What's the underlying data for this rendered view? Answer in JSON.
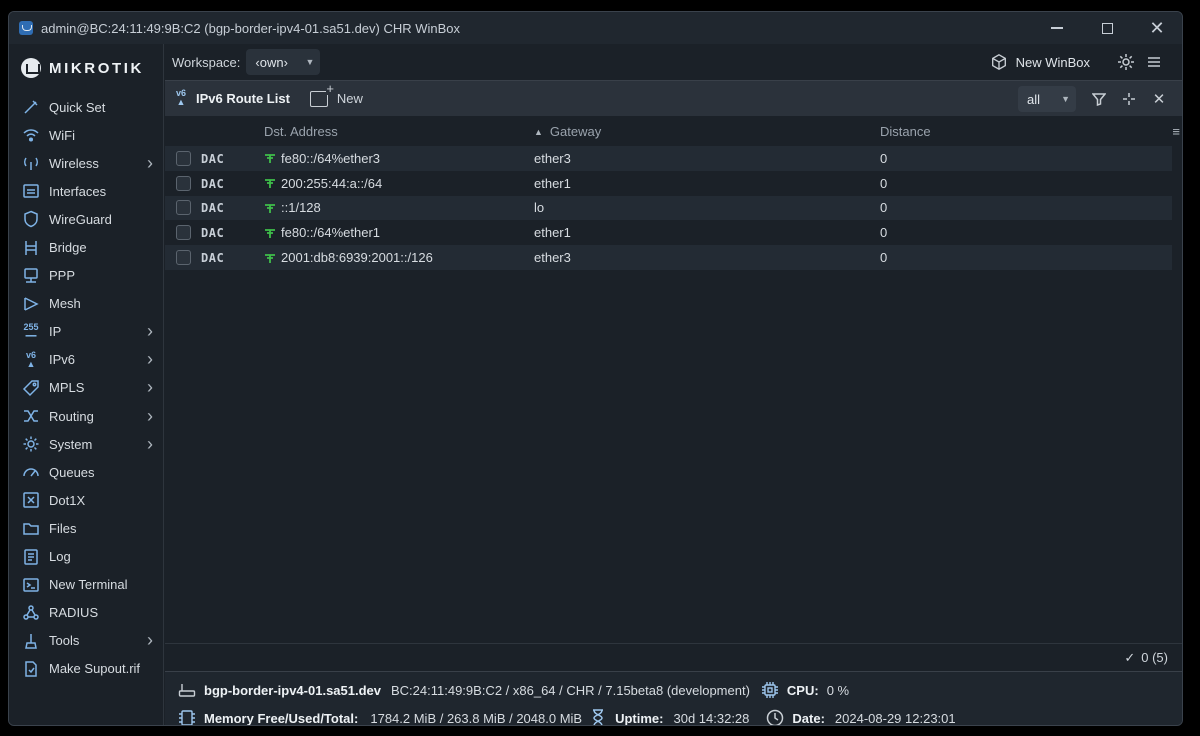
{
  "window": {
    "title": "admin@BC:24:11:49:9B:C2 (bgp-border-ipv4-01.sa51.dev) CHR WinBox"
  },
  "sidebar": {
    "brand": "MikroTik",
    "items": [
      {
        "label": "Quick Set",
        "icon": "quick-set-icon",
        "has_submenu": false
      },
      {
        "label": "WiFi",
        "icon": "wifi-icon",
        "has_submenu": false
      },
      {
        "label": "Wireless",
        "icon": "wireless-icon",
        "has_submenu": true
      },
      {
        "label": "Interfaces",
        "icon": "interfaces-icon",
        "has_submenu": false
      },
      {
        "label": "WireGuard",
        "icon": "wireguard-icon",
        "has_submenu": false
      },
      {
        "label": "Bridge",
        "icon": "bridge-icon",
        "has_submenu": false
      },
      {
        "label": "PPP",
        "icon": "ppp-icon",
        "has_submenu": false
      },
      {
        "label": "Mesh",
        "icon": "mesh-icon",
        "has_submenu": false
      },
      {
        "label": "IP",
        "icon": "ip-icon",
        "has_submenu": true
      },
      {
        "label": "IPv6",
        "icon": "ipv6-icon",
        "has_submenu": true
      },
      {
        "label": "MPLS",
        "icon": "mpls-icon",
        "has_submenu": true
      },
      {
        "label": "Routing",
        "icon": "routing-icon",
        "has_submenu": true
      },
      {
        "label": "System",
        "icon": "system-gear-icon",
        "has_submenu": true
      },
      {
        "label": "Queues",
        "icon": "queues-icon",
        "has_submenu": false
      },
      {
        "label": "Dot1X",
        "icon": "dot1x-icon",
        "has_submenu": false
      },
      {
        "label": "Files",
        "icon": "folder-icon",
        "has_submenu": false
      },
      {
        "label": "Log",
        "icon": "log-icon",
        "has_submenu": false
      },
      {
        "label": "New Terminal",
        "icon": "terminal-icon",
        "has_submenu": false
      },
      {
        "label": "RADIUS",
        "icon": "radius-icon",
        "has_submenu": false
      },
      {
        "label": "Tools",
        "icon": "tools-icon",
        "has_submenu": true
      },
      {
        "label": "Make Supout.rif",
        "icon": "supout-icon",
        "has_submenu": false
      }
    ]
  },
  "toolbar": {
    "workspace_label": "Workspace:",
    "workspace_value": "‹own›",
    "new_winbox_label": "New WinBox"
  },
  "panel": {
    "icon_text": "v6",
    "title": "IPv6 Route List",
    "new_label": "New",
    "filter_value": "all"
  },
  "table": {
    "columns": {
      "dst": "Dst. Address",
      "gateway": "Gateway",
      "distance": "Distance"
    },
    "rows": [
      {
        "flags": "DAC",
        "dst": "fe80::/64%ether3",
        "gateway": "ether3",
        "distance": "0"
      },
      {
        "flags": "DAC",
        "dst": "200:255:44:a::/64",
        "gateway": "ether1",
        "distance": "0"
      },
      {
        "flags": "DAC",
        "dst": "::1/128",
        "gateway": "lo",
        "distance": "0"
      },
      {
        "flags": "DAC",
        "dst": "fe80::/64%ether1",
        "gateway": "ether1",
        "distance": "0"
      },
      {
        "flags": "DAC",
        "dst": "2001:db8:6939:2001::/126",
        "gateway": "ether3",
        "distance": "0"
      }
    ],
    "footer_count": "0 (5)"
  },
  "status": {
    "hostname": "bgp-border-ipv4-01.sa51.dev",
    "details": "BC:24:11:49:9B:C2 / x86_64 / CHR / 7.15beta8 (development)",
    "cpu_label": "CPU:",
    "cpu_value": "0 %",
    "memory_label": "Memory Free/Used/Total:",
    "memory_value": "1784.2 MiB / 263.8 MiB / 2048.0 MiB",
    "uptime_label": "Uptime:",
    "uptime_value": "30d 14:32:28",
    "date_label": "Date:",
    "date_value": "2024-08-29 12:23:01"
  },
  "colors": {
    "window_bg": "#1b2128",
    "panel_header_bg": "#2b323b",
    "accent_icon": "#7fb3e6",
    "route_icon_green": "#3fbf4a"
  }
}
